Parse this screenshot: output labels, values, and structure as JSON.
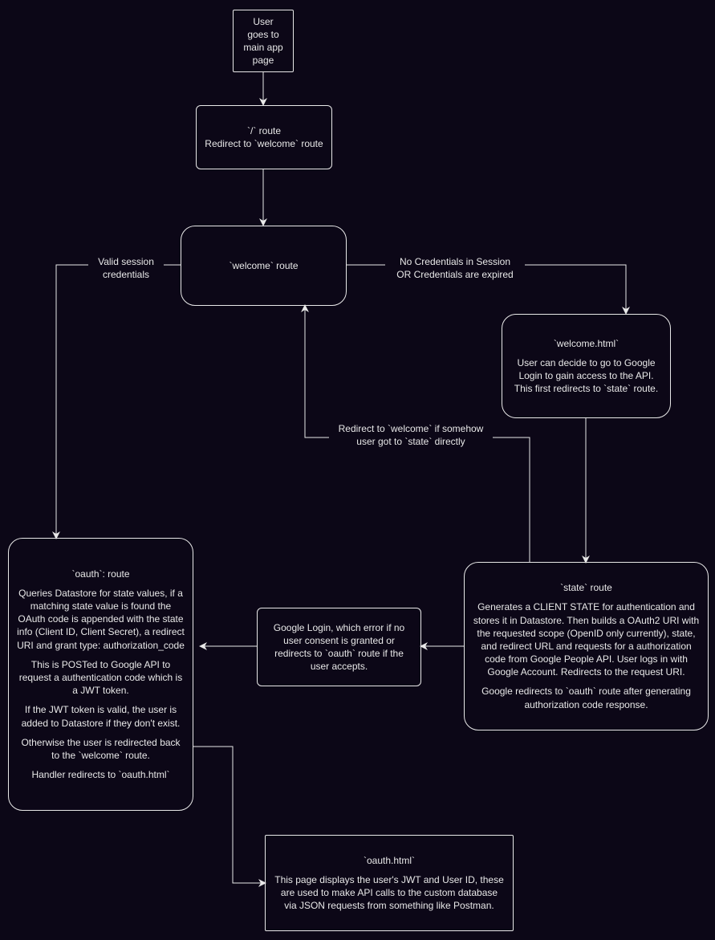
{
  "chart_data": {
    "type": "flowchart",
    "nodes": [
      {
        "id": "n1",
        "label": "User goes to main app page"
      },
      {
        "id": "n2",
        "label": "`/` route\nRedirect to `welcome` route"
      },
      {
        "id": "n3",
        "label": "`welcome` route"
      },
      {
        "id": "n4",
        "label": "`welcome.html`\n\nUser can decide to go to Google Login to gain access to the API. This first redirects to `state` route."
      },
      {
        "id": "n5",
        "label": "`state` route\n\nGenerates a CLIENT STATE for authentication and stores it in Datastore. Then builds a OAuth2 URI with the requested scope (OpenID only currently), state, and redirect URL and requests for a authorization code from Google People API. User logs in with Google Account. Redirects to the request URI.\n\nGoogle redirects to `oauth` route after generating authorization code response."
      },
      {
        "id": "n6",
        "label": "Google Login, which error if no user consent is granted or redirects to `oauth` route if the user accepts."
      },
      {
        "id": "n7",
        "label": "`oauth`: route\n\nQueries Datastore for state values, if a matching state value is found the OAuth code is appended with the state info (Client ID, Client Secret), a redirect URI and grant type: authorization_code\n\nThis is POSTed to Google API to request a authentication code which is a JWT token.\n\nIf the JWT token is valid, the user is added to Datastore if they don't exist.\n\nOtherwise the user is redirected back to the `welcome` route.\n\nHandler redirects to `oauth.html`"
      },
      {
        "id": "n8",
        "label": "`oauth.html`\n\nThis page displays the user's JWT and User ID, these are used to make API calls to the custom database via JSON requests from something like Postman."
      }
    ],
    "edges": [
      {
        "from": "n1",
        "to": "n2"
      },
      {
        "from": "n2",
        "to": "n3"
      },
      {
        "from": "n3",
        "to": "n4",
        "label": "No Credentials in Session\nOR Credentials are expired"
      },
      {
        "from": "n3",
        "to": "n7",
        "label": "Valid session credentials"
      },
      {
        "from": "n4",
        "to": "n5"
      },
      {
        "from": "n5",
        "to": "n6"
      },
      {
        "from": "n5",
        "to": "n3",
        "label": "Redirect to `welcome` if somehow user got to `state` directly"
      },
      {
        "from": "n6",
        "to": "n7"
      },
      {
        "from": "n7",
        "to": "n8"
      }
    ]
  },
  "nodes": {
    "n1": {
      "l1": "User goes to",
      "l2": "main app",
      "l3": "page"
    },
    "n2": {
      "l1": "`/` route",
      "l2": "Redirect to `welcome` route"
    },
    "n3": {
      "l1": "`welcome` route"
    },
    "n4": {
      "title": "`welcome.html`",
      "body": "User can decide to go to Google Login to gain access to the API. This first redirects to `state` route."
    },
    "n5": {
      "title": "`state` route",
      "p1": "Generates a CLIENT STATE for authentication and stores it in Datastore. Then builds a OAuth2 URI with the requested scope (OpenID only currently), state, and redirect URL and requests for a authorization code from Google People API. User logs in with Google Account. Redirects to the request URI.",
      "p2": "Google redirects to `oauth` route after generating authorization code response."
    },
    "n6": {
      "body": "Google Login, which error if no user consent is granted or redirects to `oauth` route if the user accepts."
    },
    "n7": {
      "title": "`oauth`: route",
      "p1": "Queries Datastore for state values, if a matching state value is found the OAuth code is appended with the state info (Client ID, Client Secret), a redirect URI and grant type: authorization_code",
      "p2": "This is POSTed to Google API to request a authentication code which is a JWT token.",
      "p3": "If the JWT token is valid, the user is added to Datastore if they don't exist.",
      "p4": "Otherwise the user is redirected back to the `welcome` route.",
      "p5": "Handler redirects to `oauth.html`"
    },
    "n8": {
      "title": "`oauth.html`",
      "body": "This page displays the user's JWT and User ID, these are used to make API calls to the custom database via JSON requests from something like Postman."
    }
  },
  "labels": {
    "e_welcome_right_l1": "No Credentials in Session",
    "e_welcome_right_l2": "OR Credentials are expired",
    "e_welcome_left_l1": "Valid session",
    "e_welcome_left_l2": "credentials",
    "e_state_back_l1": "Redirect to `welcome` if somehow",
    "e_state_back_l2": "user got to `state` directly"
  }
}
